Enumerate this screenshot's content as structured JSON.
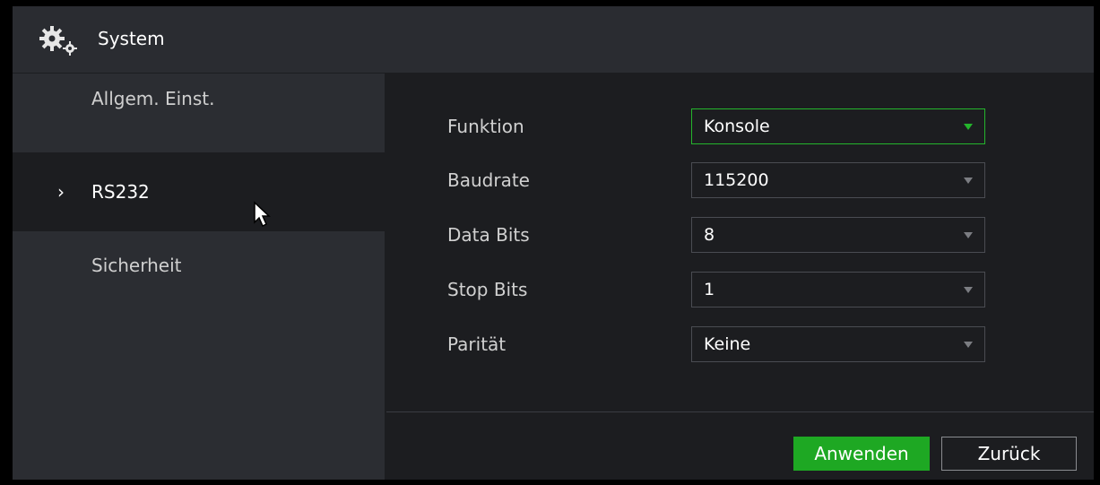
{
  "window": {
    "title": "System",
    "icon": "gears-icon"
  },
  "sidebar": {
    "items": [
      {
        "label": "Allgem. Einst."
      },
      {
        "label": "RS232",
        "active": true
      },
      {
        "label": "Sicherheit"
      }
    ],
    "active_marker": "›"
  },
  "form": {
    "funktion": {
      "label": "Funktion",
      "value": "Konsole"
    },
    "baudrate": {
      "label": "Baudrate",
      "value": "115200"
    },
    "databits": {
      "label": "Data Bits",
      "value": "8"
    },
    "stopbits": {
      "label": "Stop Bits",
      "value": "1"
    },
    "paritaet": {
      "label": "Parität",
      "value": "Keine"
    }
  },
  "buttons": {
    "apply": "Anwenden",
    "back": "Zurück"
  },
  "colors": {
    "accent": "#1ea823",
    "focus_border": "#24b52c"
  }
}
